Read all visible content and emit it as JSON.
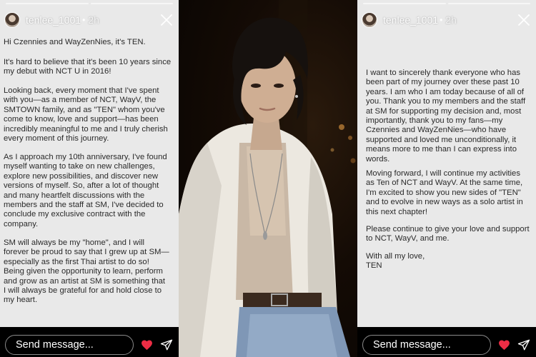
{
  "story_left": {
    "username": "tenlee_1001",
    "time": "2h",
    "paragraphs": [
      "Hi Czennies and WayZenNies, it's TEN.",
      "It's hard to believe that it's been 10 years since\nmy debut with NCT U in 2016!",
      "Looking back, every moment that I've spent\nwith you—as a member of NCT, WayV, the\nSMTOWN family, and as \"TEN\" whom you've\ncome to know, love and support—has been\nincredibly meaningful to me and I truly cherish\nevery moment of this journey.",
      "As I approach my 10th anniversary, I've found\nmyself wanting to take on new challenges,\nexplore new possibilities, and discover new\nversions of myself. So, after a lot of thought\nand many heartfelt discussions with the\nmembers and the staff at SM, I've decided to\nconclude my exclusive contract with the\ncompany.",
      "SM will always be my \"home\", and I will\nforever be proud to say that I grew up at SM—\nespecially as the first Thai artist to do so!\nBeing given the opportunity to learn, perform\nand grow as an artist at SM is something that\nI will always be grateful for and hold close to\nmy heart."
    ],
    "message_placeholder": "Send message..."
  },
  "story_right": {
    "username": "tenlee_1001",
    "time": "2h",
    "paragraphs": [
      "I want to sincerely thank everyone who has\nbeen part of my journey over these past 10\nyears. I am who I am today because of all of\nyou. Thank you to my members and the staff\nat SM for supporting my decision and, most\nimportantly, thank you to my fans—my\nCzennies and WayZenNies—who have\nsupported and loved me unconditionally, it\nmeans more to me than I can express into\nwords.",
      "Moving forward, I will continue my activities\nas Ten of NCT and WayV. At the same time,\nI'm excited to show you new sides of \"TEN\"\nand to evolve in new ways as a solo artist in\nthis next chapter!",
      "Please continue to give your love and support\nto NCT, WayV, and me.",
      "With all my love,\nTEN"
    ],
    "message_placeholder": "Send message..."
  },
  "icons": {
    "close": "close-icon",
    "heart": "heart-icon",
    "send": "send-icon"
  },
  "colors": {
    "story_background": "#e9e9e9",
    "text": "#2a2a2a",
    "heart": "#ed2d45",
    "bar": "#000000"
  }
}
